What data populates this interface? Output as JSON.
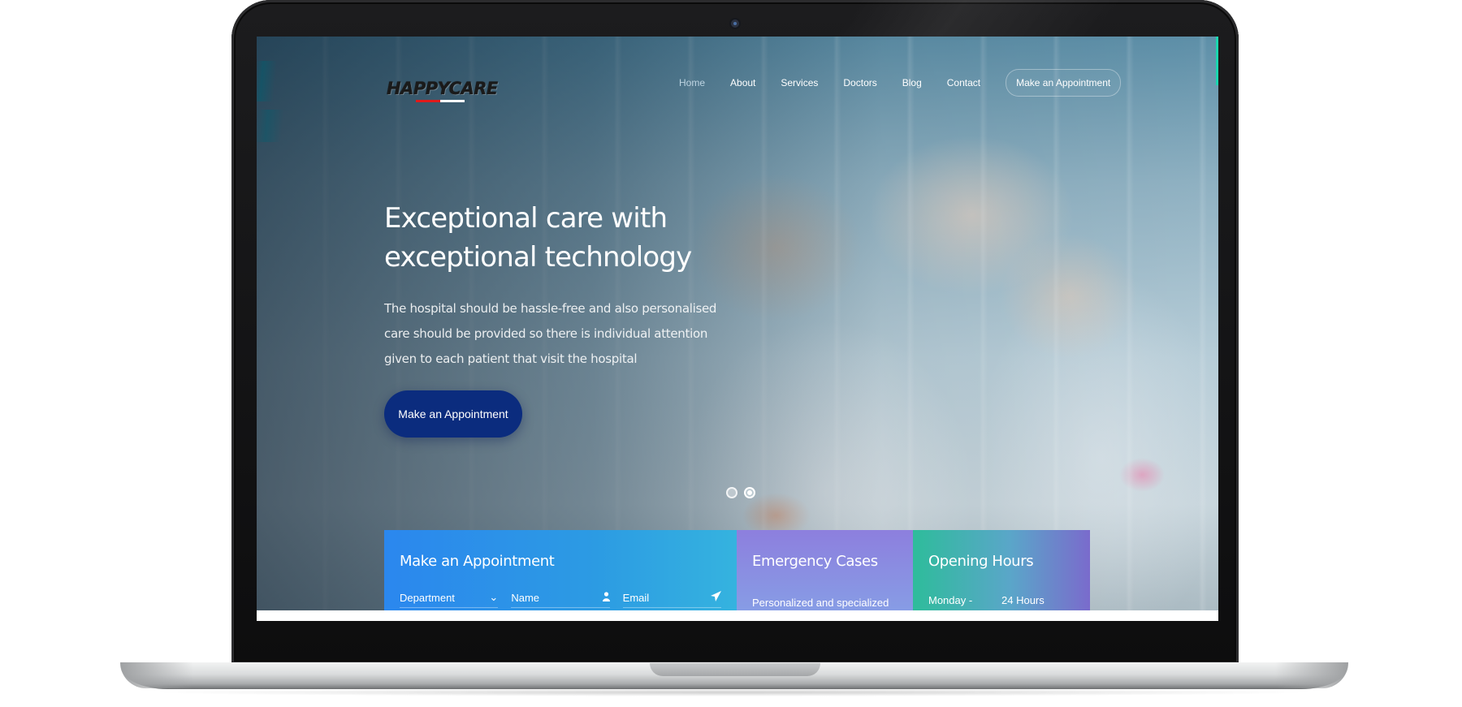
{
  "brand": {
    "logo_text": "HAPPYCARE"
  },
  "nav": {
    "items": [
      "Home",
      "About",
      "Services",
      "Doctors",
      "Blog",
      "Contact"
    ],
    "cta": "Make an Appointment"
  },
  "hero": {
    "title": "Exceptional care with exceptional technology",
    "description": "The hospital should be hassle-free and also personalised care should be provided so there is individual attention given to each patient that visit the hospital",
    "cta": "Make an Appointment",
    "slides": 2,
    "active_slide": 2
  },
  "appointment_box": {
    "title": "Make an Appointment",
    "department_label": "Department",
    "name_placeholder": "Name",
    "email_placeholder": "Email"
  },
  "emergency_box": {
    "title": "Emergency Cases",
    "text": "Personalized and specialized"
  },
  "hours_box": {
    "title": "Opening Hours",
    "day": "Monday -",
    "hours": "24 Hours"
  },
  "icons": {
    "department_chevron": "chevron-down-icon",
    "name": "user-icon",
    "email": "paper-plane-icon"
  },
  "colors": {
    "primary_button": "#0b2c7e",
    "appointment_box": "#2b87ee",
    "emergency_box": "#8d7fde",
    "hours_box": "#2ebc9b"
  }
}
